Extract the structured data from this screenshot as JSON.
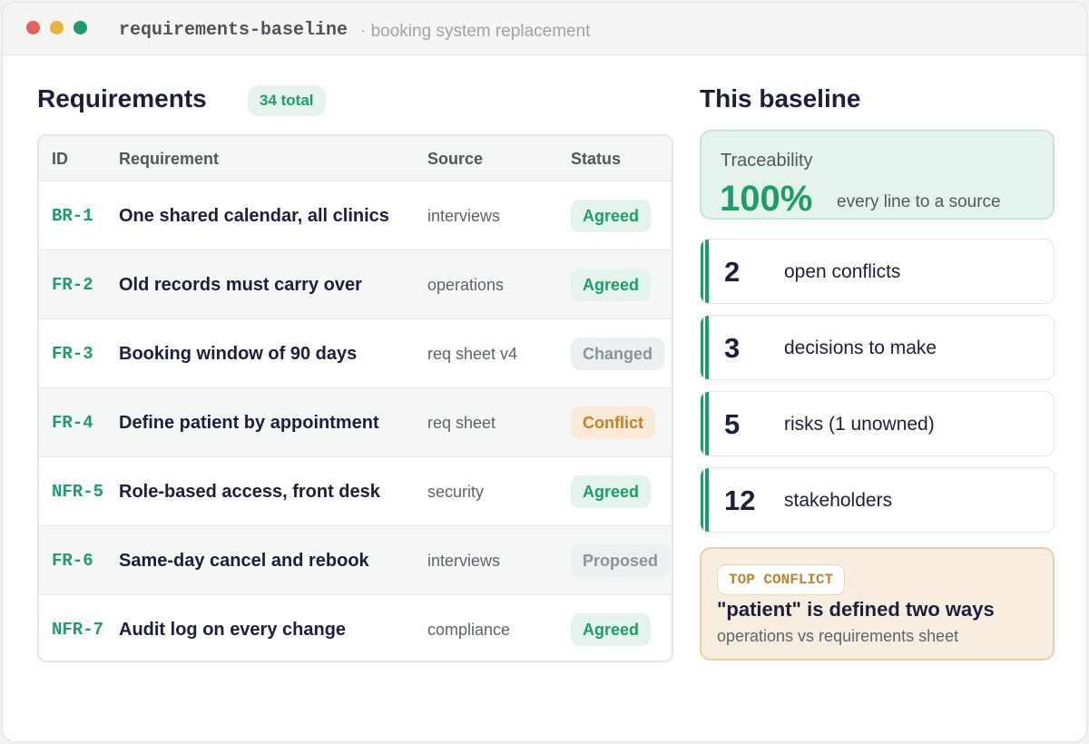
{
  "window": {
    "title": "requirements-baseline",
    "subtitle": "· booking system replacement"
  },
  "requirements": {
    "heading": "Requirements",
    "total_badge": "34 total",
    "columns": [
      "ID",
      "Requirement",
      "Source",
      "Status"
    ],
    "rows": [
      {
        "id": "BR-1",
        "requirement": "One shared calendar, all clinics",
        "source": "interviews",
        "status": "Agreed"
      },
      {
        "id": "FR-2",
        "requirement": "Old records must carry over",
        "source": "operations",
        "status": "Agreed"
      },
      {
        "id": "FR-3",
        "requirement": "Booking window of 90 days",
        "source": "req sheet v4",
        "status": "Changed"
      },
      {
        "id": "FR-4",
        "requirement": "Define patient by appointment",
        "source": "req sheet",
        "status": "Conflict"
      },
      {
        "id": "NFR-5",
        "requirement": "Role-based access, front desk",
        "source": "security",
        "status": "Agreed"
      },
      {
        "id": "FR-6",
        "requirement": "Same-day cancel and rebook",
        "source": "interviews",
        "status": "Proposed"
      },
      {
        "id": "NFR-7",
        "requirement": "Audit log on every change",
        "source": "compliance",
        "status": "Agreed"
      }
    ]
  },
  "status_colors": {
    "Agreed": {
      "bg": "#e4f4ec",
      "fg": "#1f9b6c"
    },
    "Changed": {
      "bg": "#edf0f1",
      "fg": "#8a949a"
    },
    "Proposed": {
      "bg": "#edf0f1",
      "fg": "#8a949a"
    },
    "Conflict": {
      "bg": "#f8ead6",
      "fg": "#c2822c"
    }
  },
  "baseline": {
    "heading": "This baseline",
    "traceability": {
      "label": "Traceability",
      "value": "100%",
      "note": "every line to a source"
    },
    "stats": [
      {
        "number": "2",
        "label": "open conflicts"
      },
      {
        "number": "3",
        "label": "decisions to make"
      },
      {
        "number": "5",
        "label": "risks (1 unowned)"
      },
      {
        "number": "12",
        "label": "stakeholders"
      }
    ],
    "top_conflict": {
      "tag": "TOP CONFLICT",
      "title": "\"patient\" is defined two ways",
      "subtitle": "operations vs requirements sheet"
    }
  }
}
